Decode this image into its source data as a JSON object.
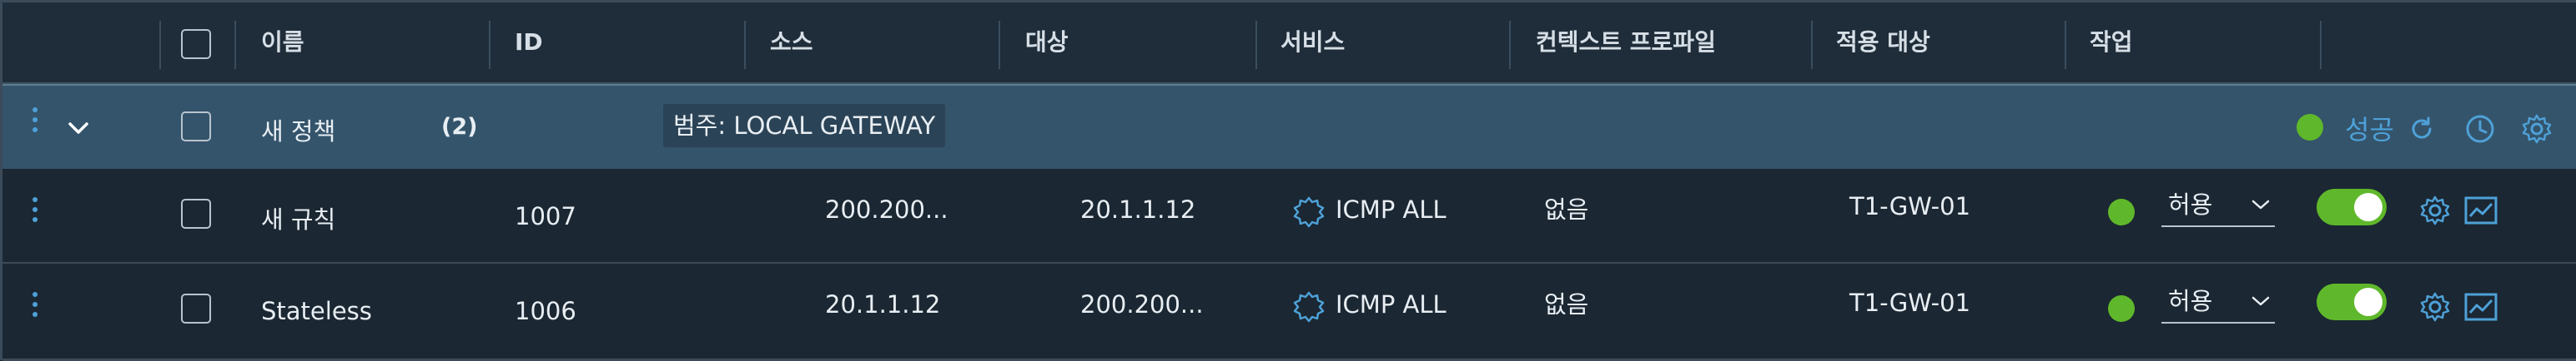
{
  "header": {
    "name": "이름",
    "id": "ID",
    "source": "소스",
    "destination": "대상",
    "services": "서비스",
    "context_profile": "컨텍스트 프로파일",
    "applied_to": "적용 대상",
    "action": "작업"
  },
  "group": {
    "name": "새 정책",
    "count": "(2)",
    "category": "범주: LOCAL GATEWAY",
    "status": "성공"
  },
  "rules": [
    {
      "name": "새 규칙",
      "id": "1007",
      "source": "200.200...",
      "destination": "20.1.1.12",
      "service": "ICMP ALL",
      "context_profile": "없음",
      "applied_to": "T1-GW-01",
      "action": "허용"
    },
    {
      "name": "Stateless",
      "id": "1006",
      "source": "20.1.1.12",
      "destination": "200.200...",
      "service": "ICMP ALL",
      "context_profile": "없음",
      "applied_to": "T1-GW-01",
      "action": "허용"
    }
  ],
  "colors": {
    "accent": "#4ea1d8",
    "success": "#5fb82b",
    "group_bg": "#34546b",
    "row_bg": "#1b2732"
  }
}
